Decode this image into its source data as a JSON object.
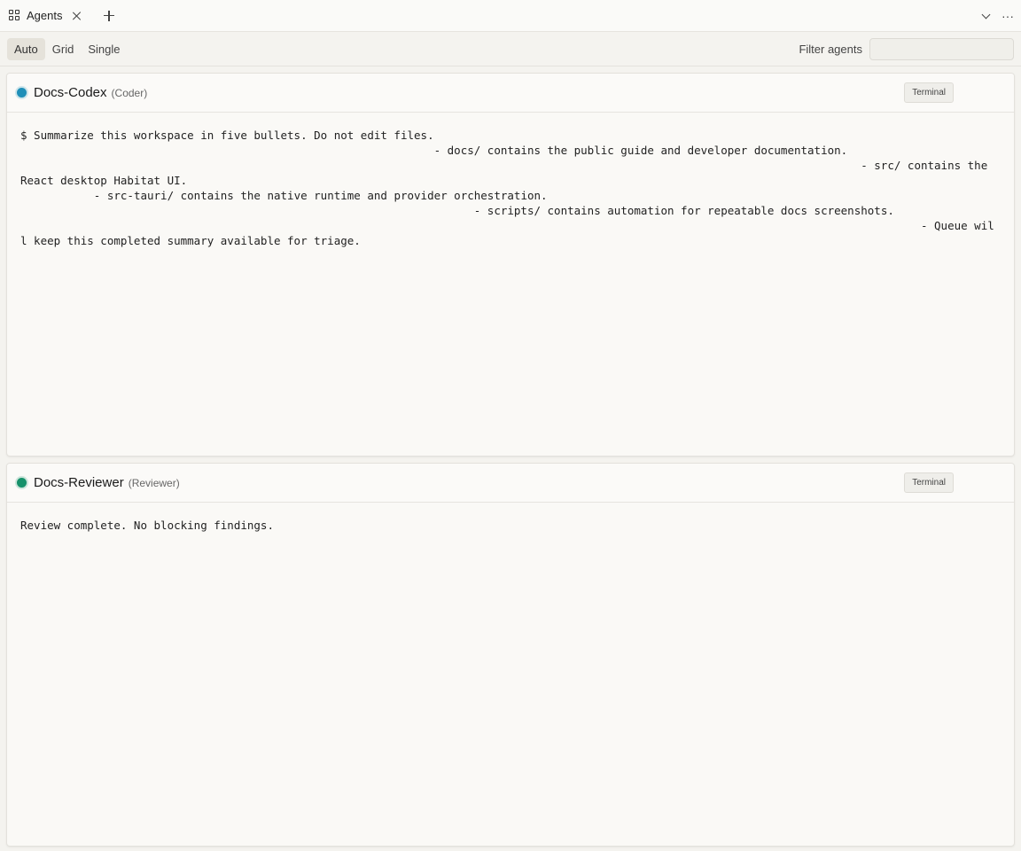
{
  "tabbar": {
    "tab_label": "Agents"
  },
  "toolbar": {
    "modes": [
      "Auto",
      "Grid",
      "Single"
    ],
    "active_mode": "Auto",
    "filter_label": "Filter agents",
    "filter_value": "",
    "filter_placeholder": ""
  },
  "agents": [
    {
      "name": "Docs-Codex",
      "role": "(Coder)",
      "status_color": "#1f8fb8",
      "terminal_label": "Terminal",
      "output": "$ Summarize this workspace in five bullets. Do not edit files.\n                                                              - docs/ contains the public guide and developer documentation.\n                                                                                                                              - src/ contains the React desktop Habitat UI.\n           - src-tauri/ contains the native runtime and provider orchestration.\n                                                                    - scripts/ contains automation for repeatable docs screenshots.\n                                                                                                                                       - Queue will keep this completed summary available for triage."
    },
    {
      "name": "Docs-Reviewer",
      "role": "(Reviewer)",
      "status_color": "#16916a",
      "terminal_label": "Terminal",
      "output": "Review complete. No blocking findings."
    }
  ]
}
